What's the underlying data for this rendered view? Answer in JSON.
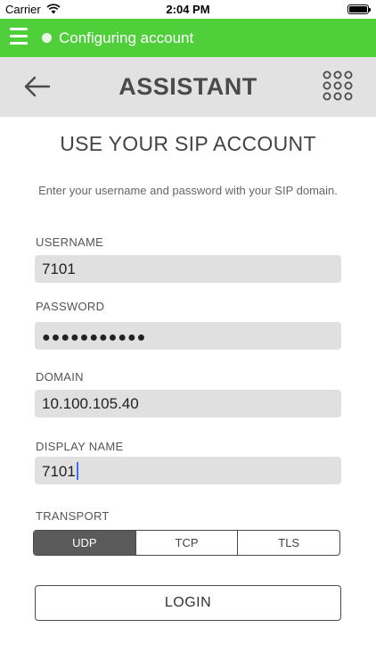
{
  "status_bar": {
    "carrier": "Carrier",
    "time": "2:04 PM"
  },
  "top_bar": {
    "status_text": "Configuring account",
    "color": "#4fcf3a"
  },
  "header": {
    "title": "ASSISTANT"
  },
  "form": {
    "title": "USE YOUR SIP ACCOUNT",
    "subtitle": "Enter your username and password with your SIP domain.",
    "username_label": "USERNAME",
    "username_value": "7101",
    "password_label": "PASSWORD",
    "password_value": "●●●●●●●●●●●",
    "domain_label": "DOMAIN",
    "domain_value": "10.100.105.40",
    "display_name_label": "DISPLAY NAME",
    "display_name_value": "7101",
    "transport_label": "TRANSPORT",
    "transport_options": [
      "UDP",
      "TCP",
      "TLS"
    ],
    "transport_selected": "UDP",
    "login_label": "LOGIN"
  },
  "icons": {
    "menu": "hamburger-icon",
    "back": "back-arrow-icon",
    "dialpad": "dialpad-icon",
    "wifi": "wifi-icon",
    "battery": "battery-icon"
  }
}
